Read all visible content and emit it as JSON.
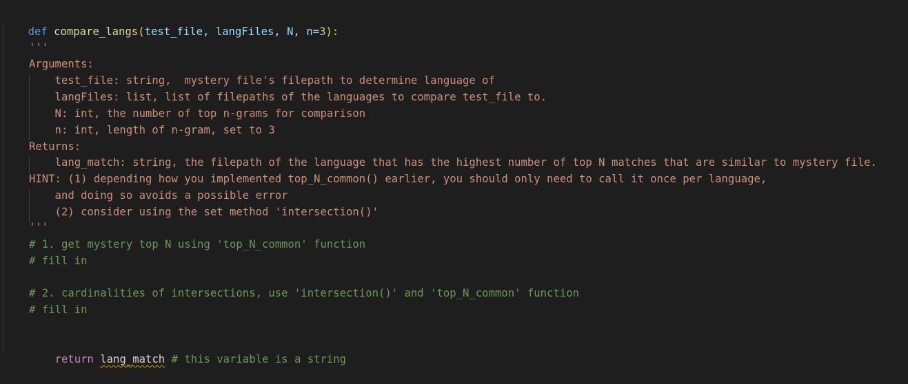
{
  "code": {
    "def_kw": "def",
    "func_name": "compare_langs",
    "open_paren": "(",
    "param_test_file": "test_file",
    "sep": ", ",
    "param_langFiles": "langFiles",
    "param_N": "N",
    "param_n": "n",
    "eq": "=",
    "default_n": "3",
    "close_sig": "):",
    "doc_open": "'''",
    "doc_lines": [
      "Arguments:",
      "    test_file: string,  mystery file's filepath to determine language of",
      "    langFiles: list, list of filepaths of the languages to compare test_file to.",
      "    N: int, the number of top n-grams for comparison",
      "    n: int, length of n-gram, set to 3",
      "Returns:",
      "    lang_match: string, the filepath of the language that has the highest number of top N matches that are similar to mystery file.",
      "HINT: (1) depending how you implemented top_N_common() earlier, you should only need to call it once per language,",
      "    and doing so avoids a possible error",
      "    (2) consider using the set method 'intersection()'"
    ],
    "doc_close": "'''",
    "comment1": "# 1. get mystery top N using 'top_N_common' function",
    "comment2": "# fill in",
    "comment3": "# 2. cardinalities of intersections, use 'intersection()' and 'top_N_common' function",
    "comment4": "# fill in",
    "return_kw": "return",
    "return_var": "lang_match",
    "return_comment": " # this variable is a string"
  },
  "colors": {
    "background": "#1e1e1e",
    "keyword": "#569cd6",
    "function": "#dcdcaa",
    "parameter": "#9cdcfe",
    "string": "#ce9178",
    "comment": "#6a9955",
    "control": "#c586c0",
    "number": "#b5cea8"
  }
}
